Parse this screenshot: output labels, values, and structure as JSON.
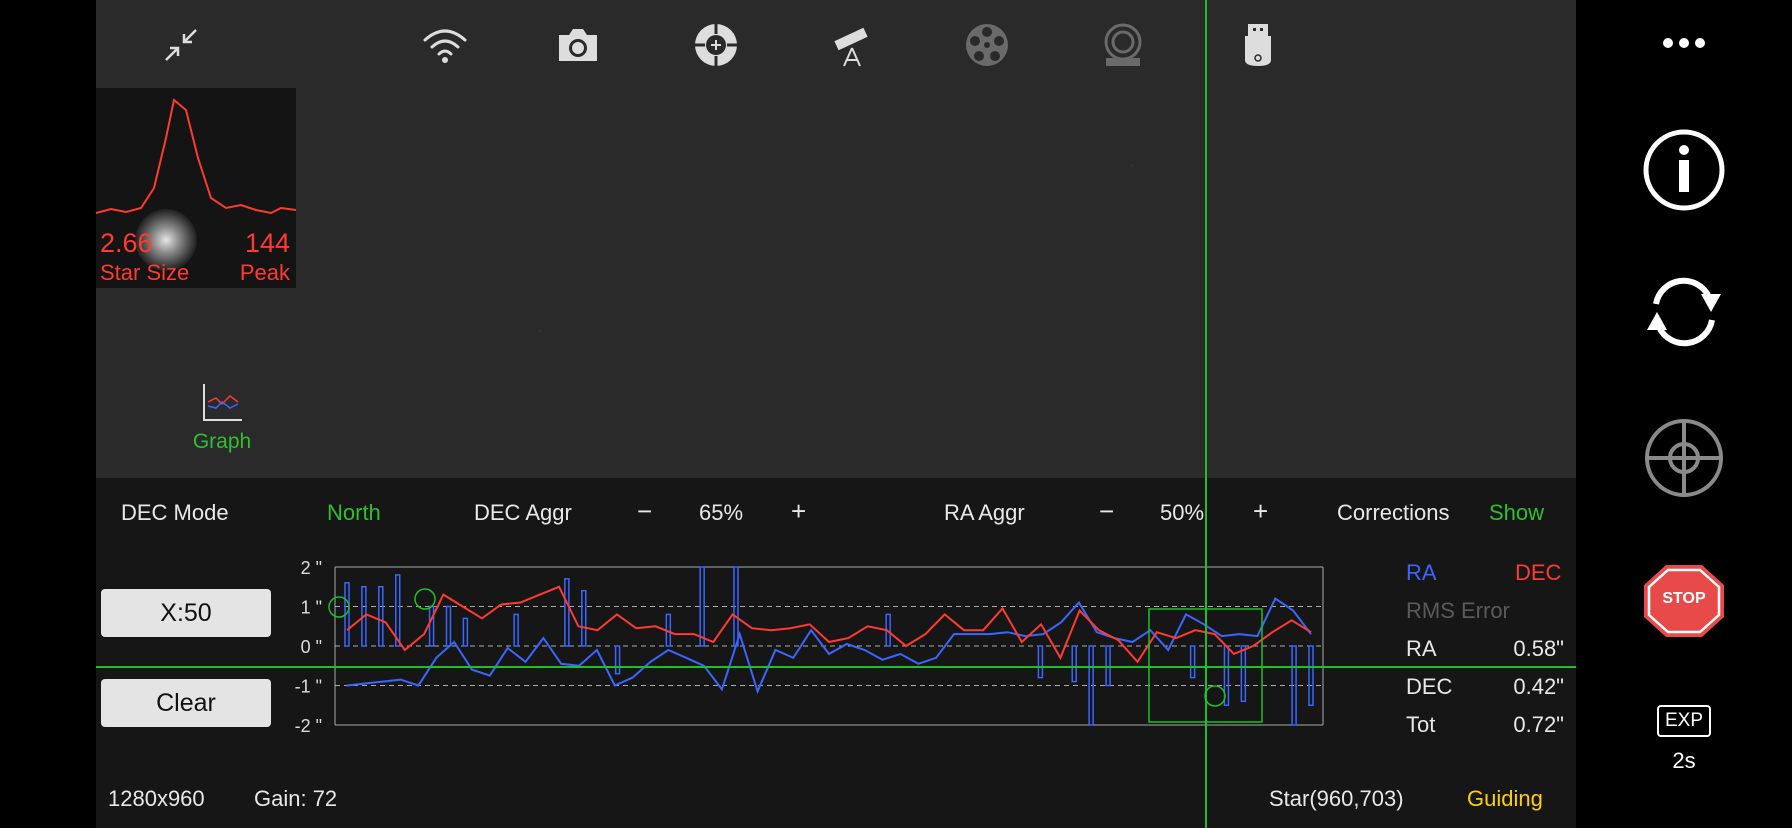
{
  "star_box": {
    "star_size_value": "2.66",
    "star_size_label": "Star Size",
    "peak_value": "144",
    "peak_label": "Peak"
  },
  "graph_label": "Graph",
  "controls": {
    "dec_mode_label": "DEC Mode",
    "dec_mode_value": "North",
    "dec_aggr_label": "DEC Aggr",
    "dec_aggr_value": "65%",
    "ra_aggr_label": "RA Aggr",
    "ra_aggr_value": "50%",
    "minus": "−",
    "plus": "+",
    "corrections_label": "Corrections",
    "corrections_value": "Show"
  },
  "buttons": {
    "scale": "X:50",
    "clear": "Clear"
  },
  "chart_data": {
    "type": "line",
    "y_ticks": [
      "2 \"",
      "1 \"",
      "0 \"",
      "-1 \"",
      "-2 \""
    ],
    "ylim": [
      -2,
      2
    ],
    "points": 50,
    "series": [
      {
        "name": "RA",
        "color": "#3a66ff",
        "values": [
          -1.0,
          -0.95,
          -0.9,
          -0.85,
          -1.0,
          -0.3,
          0.1,
          -0.6,
          -0.75,
          -0.05,
          -0.4,
          0.2,
          -0.45,
          -0.5,
          -0.1,
          -1.0,
          -0.8,
          -0.4,
          -0.1,
          -0.3,
          -0.5,
          -1.1,
          0.3,
          -1.15,
          -0.1,
          -0.3,
          0.4,
          -0.2,
          0.05,
          -0.1,
          -0.35,
          -0.2,
          -0.45,
          -0.3,
          0.3,
          0.3,
          0.3,
          0.35,
          0.25,
          0.3,
          0.6,
          1.1,
          0.35,
          0.2,
          0.1,
          0.4,
          -0.1,
          0.8,
          0.55,
          0.25,
          0.3,
          0.25,
          1.2,
          0.9,
          0.3
        ]
      },
      {
        "name": "DEC",
        "color": "#ff3b30",
        "values": [
          0.4,
          0.8,
          0.6,
          -0.1,
          0.3,
          1.3,
          1.0,
          0.7,
          1.05,
          1.1,
          1.3,
          1.5,
          0.5,
          0.4,
          0.8,
          0.45,
          0.5,
          0.3,
          0.3,
          0.1,
          0.8,
          0.45,
          0.4,
          0.45,
          0.55,
          0.1,
          0.2,
          0.5,
          0.4,
          0.0,
          0.3,
          0.8,
          0.4,
          0.4,
          0.95,
          0.1,
          0.55,
          -0.3,
          0.9,
          0.4,
          0.15,
          -0.4,
          0.35,
          0.2,
          0.4,
          0.3,
          -0.2,
          0.0,
          0.35,
          0.65,
          0.35
        ]
      }
    ],
    "ra_pulses": [
      1.6,
      1.5,
      1.5,
      1.8,
      0.0,
      1.0,
      1.0,
      0.7,
      0.0,
      0.0,
      0.8,
      0.0,
      0.0,
      1.7,
      1.4,
      0.0,
      -0.7,
      0.0,
      0.0,
      0.8,
      0.0,
      2.0,
      0.0,
      2.0,
      0.0,
      0.0,
      0.0,
      0.0,
      0.0,
      0.0,
      0.0,
      0.0,
      0.8,
      0.0,
      0.0,
      0.0,
      0.0,
      0.0,
      0.0,
      0.0,
      0.0,
      -0.8,
      0.0,
      -0.9,
      -2.0,
      -1.0,
      0.0,
      0.0,
      0.0,
      0.0,
      -0.8,
      0.0,
      -1.5,
      -1.4,
      0.0,
      0.0,
      -2.0,
      -1.5
    ],
    "legend": {
      "ra": "RA",
      "dec": "DEC"
    }
  },
  "stats": {
    "rms_title": "RMS Error",
    "ra_label": "RA",
    "ra_value": "0.58\"",
    "dec_label": "DEC",
    "dec_value": "0.42\"",
    "tot_label": "Tot",
    "tot_value": "0.72\""
  },
  "status": {
    "resolution": "1280x960",
    "gain": "Gain: 72",
    "star": "Star(960,703)",
    "state": "Guiding"
  },
  "right_bar": {
    "stop": "STOP",
    "exp_label": "EXP",
    "exp_value": "2s"
  },
  "icons": [
    "collapse-icon",
    "wifi-icon",
    "camera-icon",
    "guide-icon",
    "telescope-icon",
    "filter-wheel-icon",
    "focuser-icon",
    "usb-icon",
    "more-icon",
    "info-icon",
    "refresh-icon",
    "crosshair-icon",
    "stop-icon"
  ],
  "colors": {
    "green": "#2fbf2f",
    "ra": "#3a66ff",
    "dec": "#ff3b30",
    "guiding": "#ffd000"
  }
}
